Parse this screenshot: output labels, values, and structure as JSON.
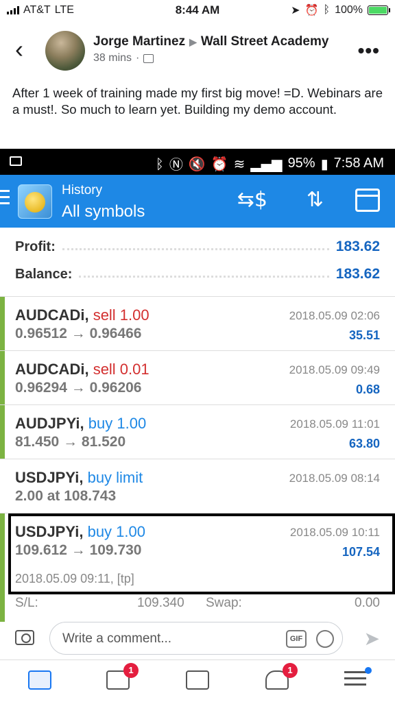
{
  "ios_status": {
    "carrier": "AT&T",
    "network": "LTE",
    "time": "8:44 AM",
    "battery": "100%",
    "battery_level": 1.0
  },
  "post": {
    "author": "Jorge Martinez",
    "group": "Wall Street Academy",
    "time": "38 mins",
    "text": "After 1 week of training made my first big move! =D. Webinars are a must!. So much to learn yet. Building my demo account."
  },
  "android_status": {
    "battery": "95%",
    "time": "7:58 AM"
  },
  "mt_app": {
    "subtitle": "History",
    "title": "All symbols",
    "profit_label": "Profit:",
    "profit_value": "183.62",
    "balance_label": "Balance:",
    "balance_value": "183.62",
    "trades": [
      {
        "symbol": "AUDCADi,",
        "action": "sell 1.00",
        "side": "sell",
        "prices": "0.96512 → 0.96466",
        "date": "2018.05.09 02:06",
        "pl": "35.51"
      },
      {
        "symbol": "AUDCADi,",
        "action": "sell 0.01",
        "side": "sell",
        "prices": "0.96294 → 0.96206",
        "date": "2018.05.09 09:49",
        "pl": "0.68"
      },
      {
        "symbol": "AUDJPYi,",
        "action": "buy 1.00",
        "side": "buy",
        "prices": "81.450 → 81.520",
        "date": "2018.05.09 11:01",
        "pl": "63.80"
      },
      {
        "symbol": "USDJPYi,",
        "action": "buy limit",
        "side": "buy",
        "prices": "2.00 at 108.743",
        "date": "2018.05.09 08:14",
        "pl": ""
      },
      {
        "symbol": "USDJPYi,",
        "action": "buy 1.00",
        "side": "buy",
        "prices": "109.612 → 109.730",
        "date": "2018.05.09 10:11",
        "pl": "107.54"
      }
    ],
    "detail_line": "2018.05.09 09:11, [tp]",
    "sl_label": "S/L:",
    "sl_value": "109.340",
    "swap_label": "Swap:",
    "swap_value": "0.00"
  },
  "composer": {
    "placeholder": "Write a comment...",
    "gif": "GIF"
  },
  "tabbar": {
    "video_badge": "1",
    "notifications_badge": "1"
  }
}
